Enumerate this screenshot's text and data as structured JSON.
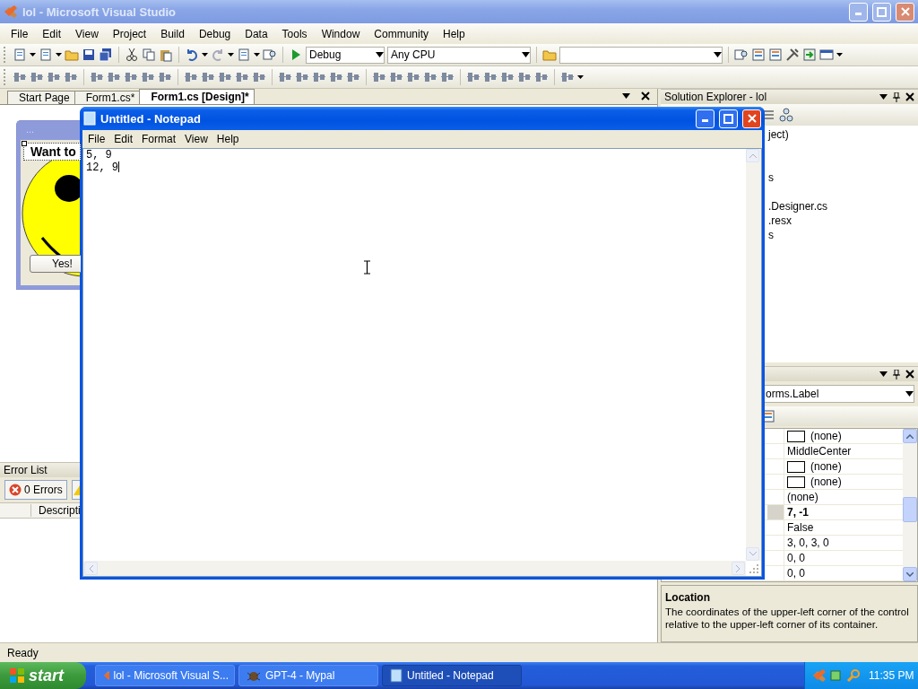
{
  "vs_window": {
    "title": "lol - Microsoft Visual Studio"
  },
  "menu": [
    "File",
    "Edit",
    "View",
    "Project",
    "Build",
    "Debug",
    "Data",
    "Tools",
    "Window",
    "Community",
    "Help"
  ],
  "toolbar": {
    "configuration": "Debug",
    "platform": "Any CPU"
  },
  "document_tabs": [
    {
      "label": "Start Page",
      "selected": false
    },
    {
      "label": "Form1.cs*",
      "selected": false
    },
    {
      "label": "Form1.cs [Design]*",
      "selected": true
    }
  ],
  "designer_form": {
    "title": "...",
    "label": "Want to",
    "button": "Yes!"
  },
  "error_list": {
    "title": "Error List",
    "errors_button": "0 Errors",
    "column": "Descripti"
  },
  "solution_explorer": {
    "title": "Solution Explorer - lol",
    "items": [
      "ject)",
      "s",
      ".Designer.cs",
      ".resx",
      "s"
    ]
  },
  "properties": {
    "object": "orms.Label",
    "rows": [
      {
        "kind": "swatch",
        "value": "(none)",
        "selected": false,
        "modified": false
      },
      {
        "kind": "text",
        "value": "MiddleCenter",
        "selected": false,
        "modified": false
      },
      {
        "kind": "swatch",
        "value": "(none)",
        "selected": false,
        "modified": false
      },
      {
        "kind": "swatch",
        "value": "(none)",
        "selected": false,
        "modified": false
      },
      {
        "kind": "text",
        "value": "(none)",
        "selected": false,
        "modified": false
      },
      {
        "kind": "text",
        "value": "7, -1",
        "selected": true,
        "modified": true
      },
      {
        "kind": "text",
        "value": "False",
        "selected": false,
        "modified": false
      },
      {
        "kind": "text",
        "value": "3, 0, 3, 0",
        "selected": false,
        "modified": false
      },
      {
        "kind": "text",
        "value": "0, 0",
        "selected": false,
        "modified": false
      },
      {
        "kind": "text",
        "value": "0, 0",
        "selected": false,
        "modified": false
      }
    ],
    "description_title": "Location",
    "description": "The coordinates of the upper-left corner of the control relative to the upper-left corner of its container."
  },
  "status_bar": "Ready",
  "notepad": {
    "title": "Untitled - Notepad",
    "menu": [
      "File",
      "Edit",
      "Format",
      "View",
      "Help"
    ],
    "text": "5, 9\n12, 9"
  },
  "taskbar": {
    "start": "start",
    "tasks": [
      {
        "label": "lol - Microsoft Visual S...",
        "selected": false
      },
      {
        "label": "GPT-4 - Mypal",
        "selected": false
      },
      {
        "label": "Untitled - Notepad",
        "selected": true
      }
    ],
    "clock": "11:35 PM"
  }
}
